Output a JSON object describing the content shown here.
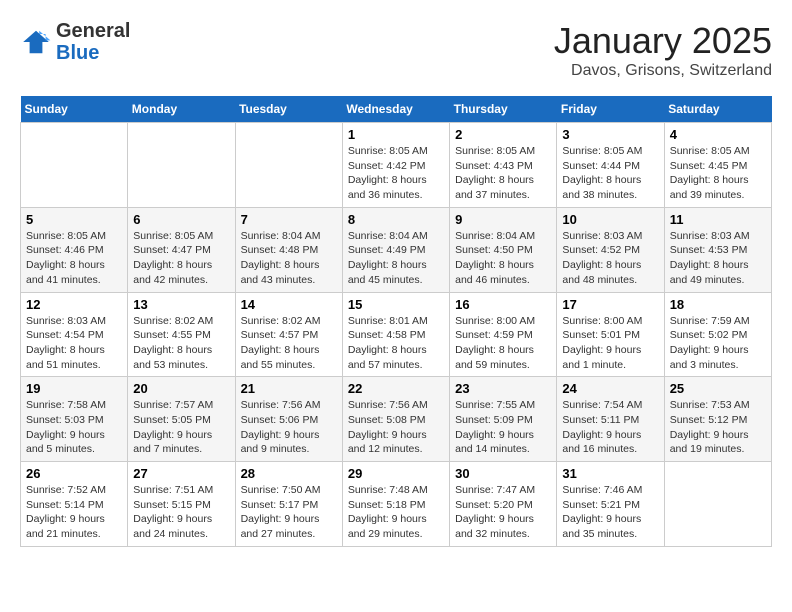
{
  "header": {
    "logo_general": "General",
    "logo_blue": "Blue",
    "month": "January 2025",
    "location": "Davos, Grisons, Switzerland"
  },
  "weekdays": [
    "Sunday",
    "Monday",
    "Tuesday",
    "Wednesday",
    "Thursday",
    "Friday",
    "Saturday"
  ],
  "weeks": [
    [
      {
        "day": "",
        "info": ""
      },
      {
        "day": "",
        "info": ""
      },
      {
        "day": "",
        "info": ""
      },
      {
        "day": "1",
        "info": "Sunrise: 8:05 AM\nSunset: 4:42 PM\nDaylight: 8 hours and 36 minutes."
      },
      {
        "day": "2",
        "info": "Sunrise: 8:05 AM\nSunset: 4:43 PM\nDaylight: 8 hours and 37 minutes."
      },
      {
        "day": "3",
        "info": "Sunrise: 8:05 AM\nSunset: 4:44 PM\nDaylight: 8 hours and 38 minutes."
      },
      {
        "day": "4",
        "info": "Sunrise: 8:05 AM\nSunset: 4:45 PM\nDaylight: 8 hours and 39 minutes."
      }
    ],
    [
      {
        "day": "5",
        "info": "Sunrise: 8:05 AM\nSunset: 4:46 PM\nDaylight: 8 hours and 41 minutes."
      },
      {
        "day": "6",
        "info": "Sunrise: 8:05 AM\nSunset: 4:47 PM\nDaylight: 8 hours and 42 minutes."
      },
      {
        "day": "7",
        "info": "Sunrise: 8:04 AM\nSunset: 4:48 PM\nDaylight: 8 hours and 43 minutes."
      },
      {
        "day": "8",
        "info": "Sunrise: 8:04 AM\nSunset: 4:49 PM\nDaylight: 8 hours and 45 minutes."
      },
      {
        "day": "9",
        "info": "Sunrise: 8:04 AM\nSunset: 4:50 PM\nDaylight: 8 hours and 46 minutes."
      },
      {
        "day": "10",
        "info": "Sunrise: 8:03 AM\nSunset: 4:52 PM\nDaylight: 8 hours and 48 minutes."
      },
      {
        "day": "11",
        "info": "Sunrise: 8:03 AM\nSunset: 4:53 PM\nDaylight: 8 hours and 49 minutes."
      }
    ],
    [
      {
        "day": "12",
        "info": "Sunrise: 8:03 AM\nSunset: 4:54 PM\nDaylight: 8 hours and 51 minutes."
      },
      {
        "day": "13",
        "info": "Sunrise: 8:02 AM\nSunset: 4:55 PM\nDaylight: 8 hours and 53 minutes."
      },
      {
        "day": "14",
        "info": "Sunrise: 8:02 AM\nSunset: 4:57 PM\nDaylight: 8 hours and 55 minutes."
      },
      {
        "day": "15",
        "info": "Sunrise: 8:01 AM\nSunset: 4:58 PM\nDaylight: 8 hours and 57 minutes."
      },
      {
        "day": "16",
        "info": "Sunrise: 8:00 AM\nSunset: 4:59 PM\nDaylight: 8 hours and 59 minutes."
      },
      {
        "day": "17",
        "info": "Sunrise: 8:00 AM\nSunset: 5:01 PM\nDaylight: 9 hours and 1 minute."
      },
      {
        "day": "18",
        "info": "Sunrise: 7:59 AM\nSunset: 5:02 PM\nDaylight: 9 hours and 3 minutes."
      }
    ],
    [
      {
        "day": "19",
        "info": "Sunrise: 7:58 AM\nSunset: 5:03 PM\nDaylight: 9 hours and 5 minutes."
      },
      {
        "day": "20",
        "info": "Sunrise: 7:57 AM\nSunset: 5:05 PM\nDaylight: 9 hours and 7 minutes."
      },
      {
        "day": "21",
        "info": "Sunrise: 7:56 AM\nSunset: 5:06 PM\nDaylight: 9 hours and 9 minutes."
      },
      {
        "day": "22",
        "info": "Sunrise: 7:56 AM\nSunset: 5:08 PM\nDaylight: 9 hours and 12 minutes."
      },
      {
        "day": "23",
        "info": "Sunrise: 7:55 AM\nSunset: 5:09 PM\nDaylight: 9 hours and 14 minutes."
      },
      {
        "day": "24",
        "info": "Sunrise: 7:54 AM\nSunset: 5:11 PM\nDaylight: 9 hours and 16 minutes."
      },
      {
        "day": "25",
        "info": "Sunrise: 7:53 AM\nSunset: 5:12 PM\nDaylight: 9 hours and 19 minutes."
      }
    ],
    [
      {
        "day": "26",
        "info": "Sunrise: 7:52 AM\nSunset: 5:14 PM\nDaylight: 9 hours and 21 minutes."
      },
      {
        "day": "27",
        "info": "Sunrise: 7:51 AM\nSunset: 5:15 PM\nDaylight: 9 hours and 24 minutes."
      },
      {
        "day": "28",
        "info": "Sunrise: 7:50 AM\nSunset: 5:17 PM\nDaylight: 9 hours and 27 minutes."
      },
      {
        "day": "29",
        "info": "Sunrise: 7:48 AM\nSunset: 5:18 PM\nDaylight: 9 hours and 29 minutes."
      },
      {
        "day": "30",
        "info": "Sunrise: 7:47 AM\nSunset: 5:20 PM\nDaylight: 9 hours and 32 minutes."
      },
      {
        "day": "31",
        "info": "Sunrise: 7:46 AM\nSunset: 5:21 PM\nDaylight: 9 hours and 35 minutes."
      },
      {
        "day": "",
        "info": ""
      }
    ]
  ]
}
